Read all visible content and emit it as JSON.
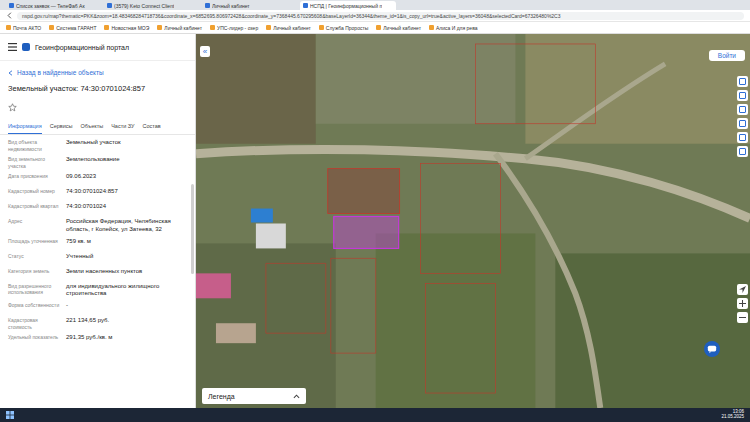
{
  "browser": {
    "tabs": [
      {
        "label": "Список заявок — ТелеФаб Ак",
        "selected": false
      },
      {
        "label": "(3579) Keto Connect Client",
        "selected": false
      },
      {
        "label": "Личный кабинет",
        "selected": false
      },
      {
        "label": "НСПД | Геоинформационный п",
        "selected": true
      }
    ],
    "url": "nspd.gov.ru/map?thematic=PKK&zoom=18.483468284718736&coordinate_x=6852695.806972428&coordinate_y=7368445.670295608&baseLayerId=36344&theme_id=1&is_copy_url=true&active_layers=36048&selectedCard=67326480%2C3",
    "bookmarks": [
      "Почта АКТО",
      "Система ГАРАНТ",
      "Новостная МОЭ",
      "Личный кабинет",
      "УПС-лидер - озер",
      "Личный кабинет",
      "Служба Проросты",
      "Личный кабинет",
      "Алиса И для рева"
    ]
  },
  "panel": {
    "portal_title": "Геоинформационный портал",
    "back": "Назад в найденные объекты",
    "title": "Земельный участок: 74:30:0701024:857",
    "tabs": [
      {
        "label": "Информация",
        "selected": true
      },
      {
        "label": "Сервисы",
        "selected": false
      },
      {
        "label": "Объекты",
        "selected": false
      },
      {
        "label": "Части ЗУ",
        "selected": false
      },
      {
        "label": "Состав",
        "selected": false
      }
    ],
    "fields": [
      {
        "label": "Вид объекта недвижимости",
        "value": "Земельный участок"
      },
      {
        "label": "Вид земельного участка",
        "value": "Землепользование"
      },
      {
        "label": "Дата присвоения",
        "value": "09.06.2023"
      },
      {
        "label": "Кадастровый номер",
        "value": "74:30:0701024:857"
      },
      {
        "label": "Кадастровый квартал",
        "value": "74:30:0701024"
      },
      {
        "label": "Адрес",
        "value": "Российская Федерация, Челябинская область, г Копейск, ул Затеева, 32"
      },
      {
        "label": "Площадь уточненная",
        "value": "759 кв. м"
      },
      {
        "label": "Статус",
        "value": "Учтенный"
      },
      {
        "label": "Категория земель",
        "value": "Земли населенных пунктов"
      },
      {
        "label": "Вид разрешенного использования",
        "value": "для индивидуального жилищного строительства"
      },
      {
        "label": "Форма собственности",
        "value": "-"
      },
      {
        "label": "Кадастровая стоимость",
        "value": "221 134,65 руб."
      },
      {
        "label": "Удельный показатель",
        "value": "291,35 руб./кв. м"
      }
    ]
  },
  "map": {
    "collapse": "«",
    "login": "Войти",
    "legend": "Легенда"
  },
  "taskbar": {
    "time": "13:06",
    "date": "21.05.2025"
  }
}
